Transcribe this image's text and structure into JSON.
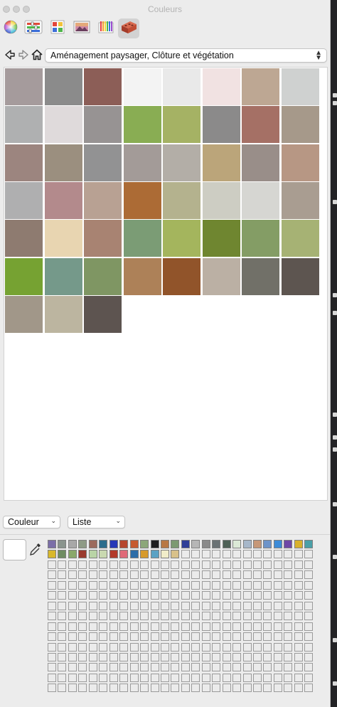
{
  "window": {
    "title": "Couleurs"
  },
  "toolbar": {
    "tabs": [
      {
        "name": "color-wheel-icon",
        "active": false
      },
      {
        "name": "sliders-icon",
        "active": false
      },
      {
        "name": "palettes-icon",
        "active": false
      },
      {
        "name": "image-palette-icon",
        "active": false
      },
      {
        "name": "crayons-icon",
        "active": false
      },
      {
        "name": "materials-brick-icon",
        "active": true
      }
    ]
  },
  "nav": {
    "back_icon": "back-arrow-icon",
    "forward_icon": "forward-arrow-icon",
    "home_icon": "home-icon",
    "collection": "Aménagement paysager, Clôture et végétation"
  },
  "swatches": [
    "#a59b9c",
    "#8b8b8b",
    "#8c5e57",
    "#f3f3f3",
    "#e9e9e9",
    "#f1e2e2",
    "#bda793",
    "#cfd1d0",
    "#afb0b1",
    "#dfdadb",
    "#979393",
    "#89ad53",
    "#a5b264",
    "#8b8a8a",
    "#a57065",
    "#a6998a",
    "#9c857f",
    "#9b8f7f",
    "#929293",
    "#a39b98",
    "#b3aea7",
    "#bba57a",
    "#998e89",
    "#b79784",
    "#afafb0",
    "#b38a8c",
    "#b8a193",
    "#ac6b35",
    "#b4b28e",
    "#cdcdc3",
    "#d6d6d2",
    "#a99d91",
    "#8e7b70",
    "#e8d5b1",
    "#a88372",
    "#7b9c75",
    "#a4b55d",
    "#6f8630",
    "#849d65",
    "#a6b274",
    "#76a232",
    "#75998a",
    "#7f9663",
    "#ad8158",
    "#91542a",
    "#bbb0a4",
    "#717068",
    "#5d5550",
    "#a19789",
    "#bcb5a0",
    "#5d5450"
  ],
  "controls": {
    "mode": "Couleur",
    "view": "Liste"
  },
  "current_color": "#ffffff",
  "eyedropper_icon": "eyedropper-icon",
  "favorites": {
    "row1": [
      "#7b6fa8",
      "#8a948d",
      "#a8a8a8",
      "#8e9b86",
      "#9c6a5c",
      "#2c6d8c",
      "#2538b7",
      "#b6462e",
      "#c65a2f",
      "#8ca77a",
      "#1f1f1f",
      "#b87845",
      "#7c9a72",
      "#2f3f98",
      "#b6b6b6",
      "#8a8a8a",
      "#6a7274",
      "#4e6156",
      "#dbe9d6",
      "#a7b7c9",
      "#c69777",
      "#6e94c9",
      "#3c8bd8",
      "#6f48a6",
      "#d8b12c",
      "#4aa0a8"
    ],
    "row2": [
      "#d8b82c",
      "#6f8c62",
      "#8aa86a",
      "#9a3a2e",
      "#b9d4a6",
      "#c9d9b0",
      "#b23a2a",
      "#e06a78",
      "#2d6da8",
      "#d69a2c",
      "#5ba2c4",
      "#f1edc9",
      "#d8c18a"
    ]
  }
}
